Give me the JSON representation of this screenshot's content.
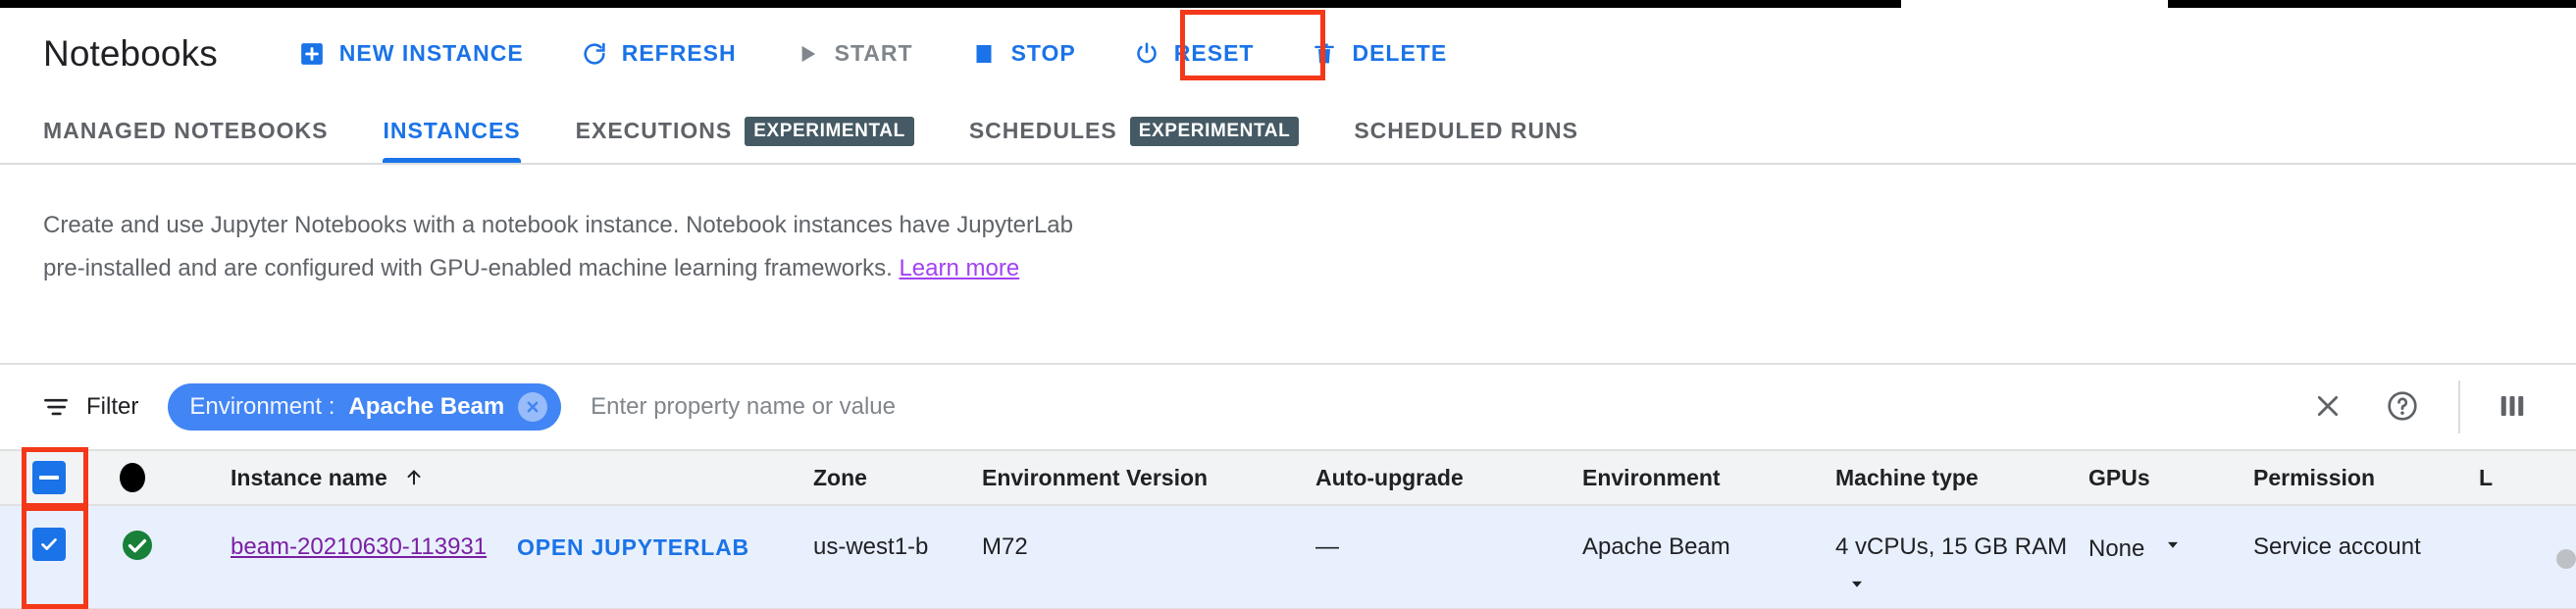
{
  "header": {
    "title": "Notebooks",
    "toolbar": [
      {
        "label": "NEW INSTANCE",
        "icon": "plus-box-icon",
        "state": "enabled"
      },
      {
        "label": "REFRESH",
        "icon": "refresh-icon",
        "state": "enabled"
      },
      {
        "label": "START",
        "icon": "play-icon",
        "state": "disabled"
      },
      {
        "label": "STOP",
        "icon": "stop-square-icon",
        "state": "enabled"
      },
      {
        "label": "RESET",
        "icon": "power-reset-icon",
        "state": "enabled",
        "highlighted": true
      },
      {
        "label": "DELETE",
        "icon": "trash-icon",
        "state": "enabled"
      }
    ]
  },
  "tabs": [
    {
      "label": "MANAGED NOTEBOOKS",
      "badge": "",
      "active": false
    },
    {
      "label": "INSTANCES",
      "badge": "",
      "active": true
    },
    {
      "label": "EXECUTIONS",
      "badge": "EXPERIMENTAL",
      "active": false
    },
    {
      "label": "SCHEDULES",
      "badge": "EXPERIMENTAL",
      "active": false
    },
    {
      "label": "SCHEDULED RUNS",
      "badge": "",
      "active": false
    }
  ],
  "description": {
    "text": "Create and use Jupyter Notebooks with a notebook instance. Notebook instances have JupyterLab pre-installed and are configured with GPU-enabled machine learning frameworks.",
    "link_label": "Learn more"
  },
  "filter": {
    "label": "Filter",
    "filter_icon": "filter-list-icon",
    "chip": {
      "key": "Environment :",
      "value": "Apache Beam",
      "remove_icon": "chip-close-icon"
    },
    "placeholder": "Enter property name or value",
    "value": "",
    "actions": [
      {
        "name": "clear-filter-button",
        "icon": "close-icon"
      },
      {
        "name": "help-button",
        "icon": "help-circle-icon"
      },
      {
        "name": "column-display-options-button",
        "icon": "columns-icon"
      }
    ]
  },
  "table": {
    "select_all_state": "indeterminate",
    "columns": [
      "",
      "",
      "Instance name",
      "",
      "Zone",
      "Environment Version",
      "Auto-upgrade",
      "Environment",
      "Machine type",
      "GPUs",
      "Permission",
      "L"
    ],
    "sort_column": "Instance name",
    "sort_direction": "ascending",
    "rows": [
      {
        "selected": true,
        "status": "running",
        "instance_name": "beam-20210630-113931",
        "open_jupyterlab": "OPEN JUPYTERLAB",
        "zone": "us-west1-b",
        "environment_version": "M72",
        "auto_upgrade": "—",
        "environment": "Apache Beam",
        "machine_type": "4 vCPUs, 15 GB RAM",
        "gpus": "None",
        "permission": "Service account"
      }
    ]
  },
  "colors": {
    "accent_blue": "#1a73e8",
    "chip_blue": "#4285f4",
    "highlight_red": "#f4381a",
    "link_purple": "#7b1fa2",
    "status_green": "#188038",
    "badge_slate": "#455a64",
    "row_selected_bg": "#e8f0fe",
    "header_bg": "#f1f3f4"
  }
}
